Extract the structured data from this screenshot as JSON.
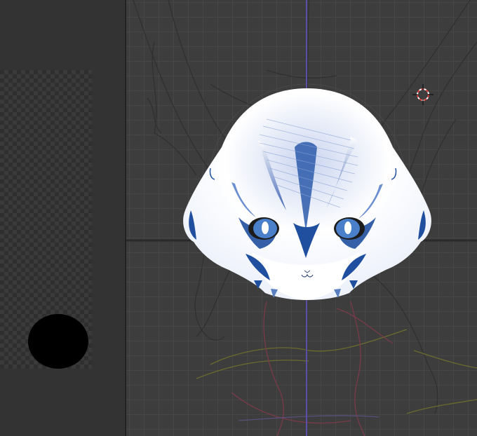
{
  "editor": {
    "left_panel": "image-preview-panel",
    "viewport": "3d-viewport"
  },
  "icons": {
    "cursor": "3d-cursor-icon",
    "brush": "brush-dot"
  },
  "colors": {
    "axis_vertical": "#5a4fa8",
    "axis_horizontal": "#2a2a2a",
    "cursor_ring": "#e04040",
    "face_white": "#ffffff",
    "face_blue": "#1f4f9e",
    "eye_blue": "#4a7fc9",
    "sketch_lines": "#2a2a2a",
    "body_lines_red": "#7a3a4a",
    "body_lines_olive": "#6b6b2f"
  }
}
